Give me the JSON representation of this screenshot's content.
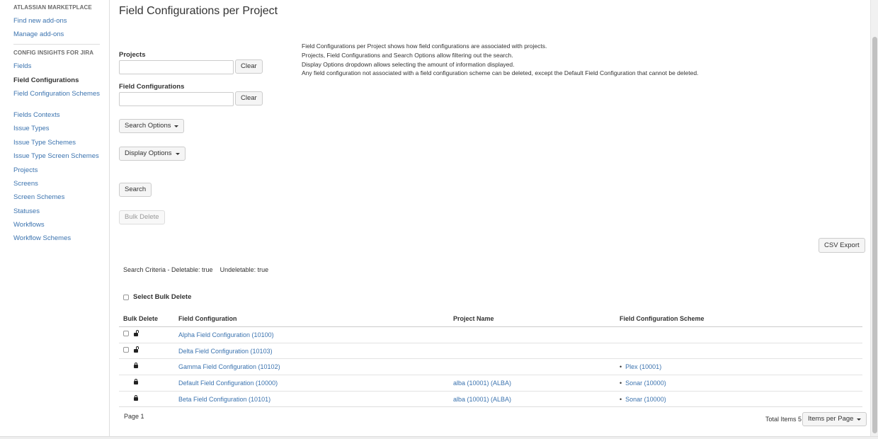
{
  "sidebar": {
    "marketplace_heading": "ATLASSIAN MARKETPLACE",
    "find_addons": "Find new add-ons",
    "manage_addons": "Manage add-ons",
    "config_heading": "CONFIG INSIGHTS FOR JIRA",
    "items": [
      {
        "label": "Fields"
      },
      {
        "label": "Field Configurations"
      },
      {
        "label": "Field Configuration Schemes"
      },
      {
        "label": "Fields Contexts"
      },
      {
        "label": "Issue Types"
      },
      {
        "label": "Issue Type Schemes"
      },
      {
        "label": "Issue Type Screen Schemes"
      },
      {
        "label": "Projects"
      },
      {
        "label": "Screens"
      },
      {
        "label": "Screen Schemes"
      },
      {
        "label": "Statuses"
      },
      {
        "label": "Workflows"
      },
      {
        "label": "Workflow Schemes"
      }
    ],
    "active_item": "Field Configurations"
  },
  "main": {
    "title": "Field Configurations per Project",
    "projects_label": "Projects",
    "field_configs_label": "Field Configurations",
    "clear_label": "Clear",
    "search_options_label": "Search Options",
    "display_options_label": "Display Options",
    "search_label": "Search",
    "bulk_delete_label": "Bulk Delete",
    "csv_export_label": "CSV Export",
    "info_lines": [
      "Field Configurations per Project shows how field configurations are associated with projects.",
      "Projects, Field Configurations and Search Options allow filtering out the search.",
      "Display Options dropdown allows selecting the amount of information displayed.",
      "Any field configuration not associated with a field configuration scheme can be deleted, except the Default Field Configuration that cannot be deleted."
    ],
    "criteria_prefix": "Search Criteria - ",
    "criteria_deletable": "Deletable: true",
    "criteria_undeletable": "Undeletable: true",
    "select_bulk_delete": "Select Bulk Delete"
  },
  "table": {
    "headers": [
      "Bulk Delete",
      "Field Configuration",
      "Project Name",
      "Field Configuration Scheme"
    ],
    "rows": [
      {
        "deletable": true,
        "config": "Alpha Field Configuration (10100)",
        "project": "",
        "scheme": ""
      },
      {
        "deletable": true,
        "config": "Delta Field Configuration (10103)",
        "project": "",
        "scheme": ""
      },
      {
        "deletable": false,
        "config": "Gamma Field Configuration (10102)",
        "project": "",
        "scheme": "Plex (10001)"
      },
      {
        "deletable": false,
        "config": "Default Field Configuration (10000)",
        "project": "alba (10001) (ALBA)",
        "scheme": "Sonar (10000)"
      },
      {
        "deletable": false,
        "config": "Beta Field Configuration (10101)",
        "project": "alba (10001) (ALBA)",
        "scheme": "Sonar (10000)"
      }
    ]
  },
  "footer": {
    "page": "Page 1",
    "total": "Total Items 5",
    "items_per_page": "Items per Page"
  },
  "colors": {
    "link": "#3b73af",
    "text": "#333333",
    "border": "#cccccc"
  }
}
